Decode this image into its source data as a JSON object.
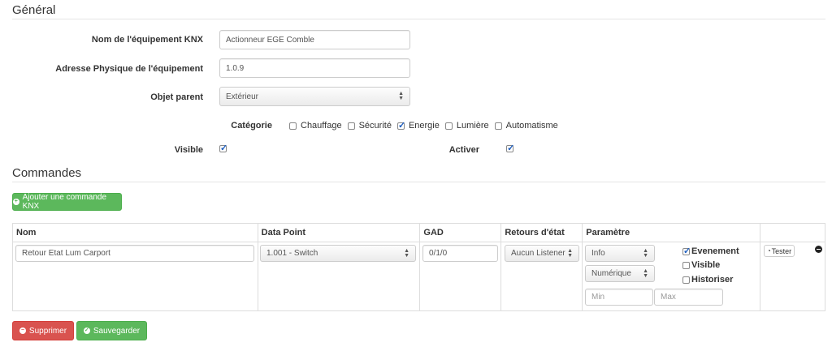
{
  "general": {
    "title": "Général",
    "name_label": "Nom de l'équipement KNX",
    "name_value": "Actionneur EGE Comble",
    "address_label": "Adresse Physique de l'équipement",
    "address_value": "1.0.9",
    "parent_label": "Objet parent",
    "parent_value": "Extérieur",
    "category_label": "Catégorie",
    "categories": [
      {
        "label": "Chauffage",
        "checked": false
      },
      {
        "label": "Sécurité",
        "checked": false
      },
      {
        "label": "Energie",
        "checked": true
      },
      {
        "label": "Lumière",
        "checked": false
      },
      {
        "label": "Automatisme",
        "checked": false
      }
    ],
    "visible_label": "Visible",
    "visible_checked": true,
    "activer_label": "Activer",
    "activer_checked": true
  },
  "commands": {
    "title": "Commandes",
    "add_button": "Ajouter une commande KNX",
    "headers": [
      "Nom",
      "Data Point",
      "GAD",
      "Retours d'état",
      "Paramètre",
      ""
    ],
    "row": {
      "name": "Retour Etat Lum Carport",
      "data_point": "1.001 - Switch",
      "gad": "0/1/0",
      "retour": "Aucun Listener",
      "type": "Info",
      "subtype": "Numérique",
      "min_placeholder": "Min",
      "max_placeholder": "Max",
      "evenement": "Evenement",
      "evenement_checked": true,
      "visible": "Visible",
      "visible_checked": false,
      "historiser": "Historiser",
      "historiser_checked": false,
      "test_button": "Tester"
    }
  },
  "footer": {
    "delete_button": "Supprimer",
    "save_button": "Sauvegarder"
  },
  "colors": {
    "green": "#5cb85c",
    "red": "#d9534f",
    "check_blue": "#1f5fbf"
  }
}
